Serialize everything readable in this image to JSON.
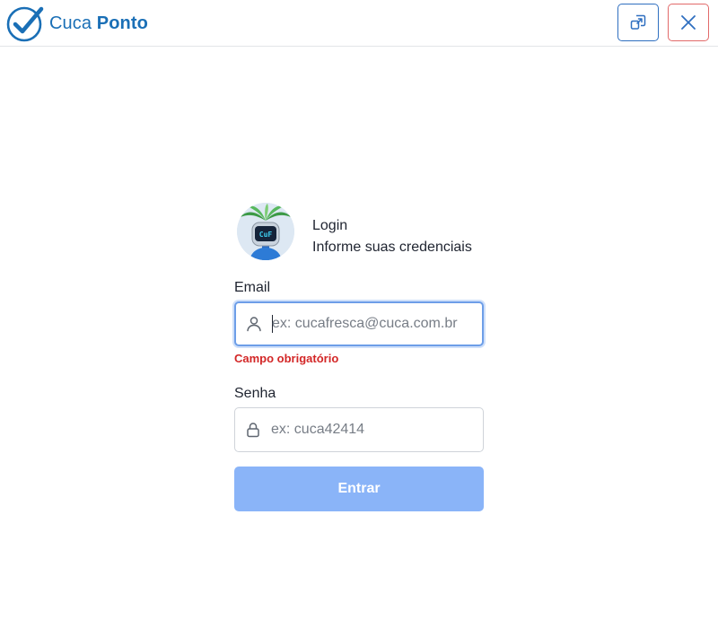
{
  "app": {
    "brand_light": "Cuca",
    "brand_bold": "Ponto",
    "brand_color": "#1a6fb6"
  },
  "header": {
    "window_button_icon": "external-window-icon",
    "close_button_icon": "close-icon"
  },
  "login": {
    "title": "Login",
    "subtitle": "Informe suas credenciais",
    "avatar_icon": "robot-palm-avatar",
    "email_label": "Email",
    "email_value": "",
    "email_placeholder": "ex: cucafresca@cuca.com.br",
    "email_icon": "user-icon",
    "email_error": "Campo obrigatório",
    "password_label": "Senha",
    "password_value": "",
    "password_placeholder": "ex: cuca42414",
    "password_icon": "lock-icon",
    "submit_label": "Entrar"
  },
  "colors": {
    "accent": "#2f6fc0",
    "error": "#d32727",
    "submit_disabled": "#8ab4f8",
    "close_border": "#e26a6a"
  }
}
